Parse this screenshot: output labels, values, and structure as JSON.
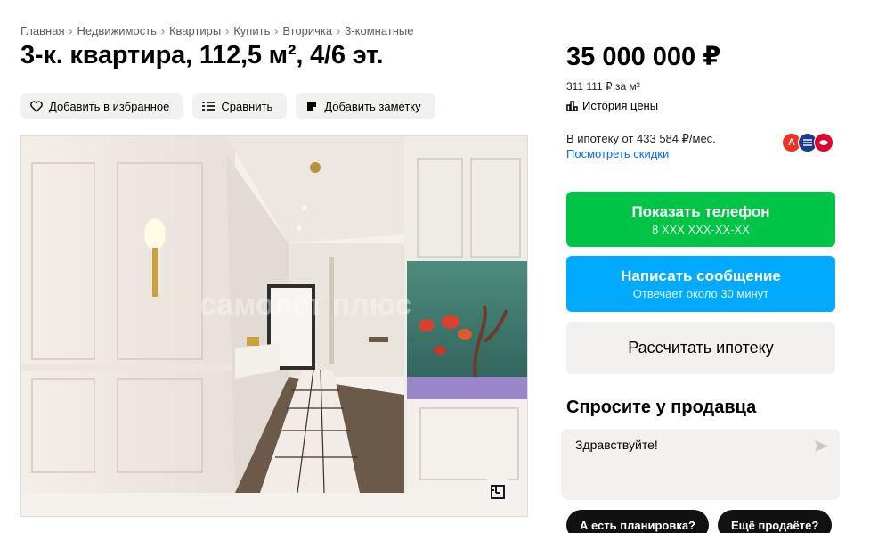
{
  "breadcrumb": [
    "Главная",
    "Недвижимость",
    "Квартиры",
    "Купить",
    "Вторичка",
    "3-комнатные"
  ],
  "listing": {
    "title": "3-к. квартира, 112,5 м², 4/6 эт.",
    "price": "35 000 000 ₽",
    "price_per_m": "311 111 ₽ за м²",
    "price_history": "История цены"
  },
  "actions": {
    "favorite": "Добавить в избранное",
    "compare": "Сравнить",
    "note": "Добавить заметку"
  },
  "photo": {
    "watermark_text": "самолет плюс"
  },
  "mortgage": {
    "text": "В ипотеку от 433 584 ₽/мес.",
    "discounts_link": "Посмотреть скидки",
    "banks": [
      {
        "letter": "А",
        "color": "#ef3124"
      },
      {
        "letter": "",
        "color": "#1e3a8a"
      },
      {
        "letter": "",
        "color": "#e4002b"
      }
    ]
  },
  "cta": {
    "phone_label": "Показать телефон",
    "phone_number": "8 XXX XXX-XX-XX",
    "message_label": "Написать сообщение",
    "message_sub": "Отвечает около 30 минут",
    "mortgage_label": "Рассчитать ипотеку"
  },
  "ask_seller": {
    "title": "Спросите у продавца",
    "input_value": "Здравствуйте!",
    "chips": [
      "А есть планировка?",
      "Ещё продаёте?"
    ]
  },
  "colors": {
    "phone_button": "#00c445",
    "message_button": "#00aaff",
    "link": "#0468ff",
    "neutral_button": "#f2f1f0"
  }
}
